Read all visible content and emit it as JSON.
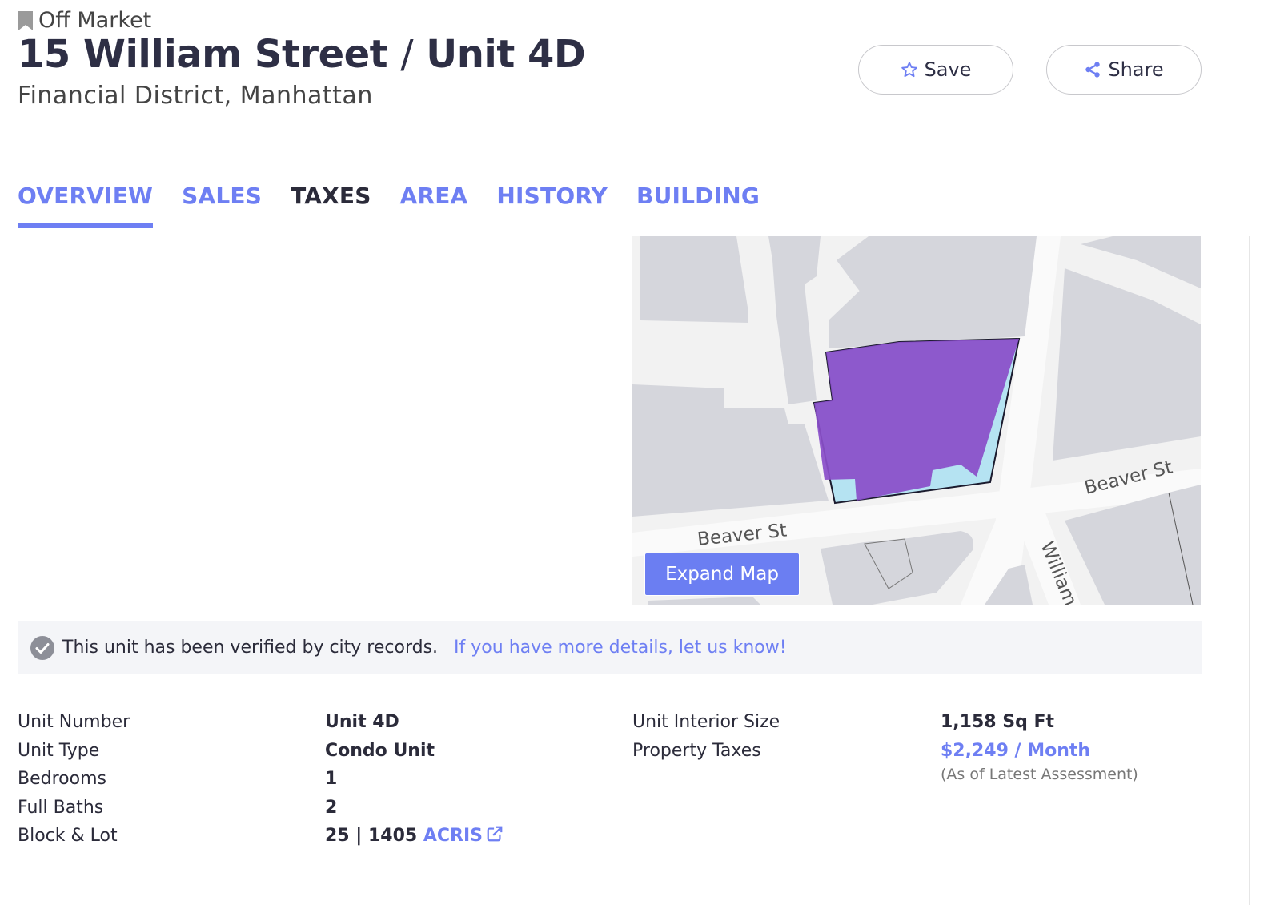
{
  "header": {
    "status": "Off Market",
    "address": "15 William Street",
    "separator": "/",
    "unit": "Unit 4D",
    "neighborhood": "Financial District, Manhattan",
    "save_label": "Save",
    "share_label": "Share"
  },
  "tabs": [
    {
      "label": "OVERVIEW",
      "active": true
    },
    {
      "label": "SALES"
    },
    {
      "label": "TAXES"
    },
    {
      "label": "AREA"
    },
    {
      "label": "HISTORY"
    },
    {
      "label": "BUILDING"
    }
  ],
  "map": {
    "street_labels": [
      "Beaver St",
      "Beaver St",
      "William"
    ],
    "expand_label": "Expand Map",
    "lot_color": "#8a4fc9",
    "parcel_color": "#b5e3f2"
  },
  "verify": {
    "text": "This unit has been verified by city records.",
    "link": "If you have more details, let us know!"
  },
  "details": {
    "left": [
      {
        "label": "Unit Number",
        "value": "Unit 4D"
      },
      {
        "label": "Unit Type",
        "value": "Condo Unit"
      },
      {
        "label": "Bedrooms",
        "value": "1"
      },
      {
        "label": "Full Baths",
        "value": "2"
      },
      {
        "label": "Block & Lot",
        "value": "25 | 1405",
        "link": "ACRIS"
      }
    ],
    "right": [
      {
        "label": "Unit Interior Size",
        "value": "1,158 Sq Ft"
      },
      {
        "label": "Property Taxes",
        "value": "$2,249 / Month",
        "note": "(As of Latest Assessment)"
      }
    ]
  },
  "colors": {
    "accent": "#6e7ff3",
    "title": "#2e2f45"
  }
}
